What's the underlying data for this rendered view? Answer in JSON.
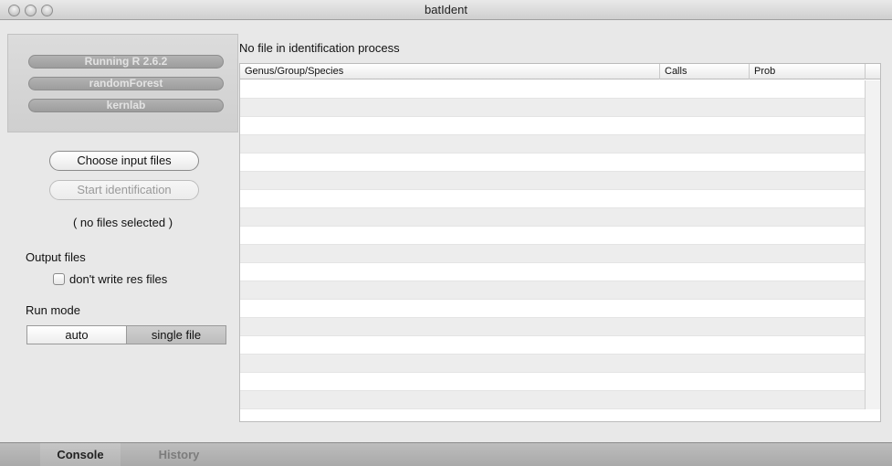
{
  "window": {
    "title": "batIdent"
  },
  "left_panel": {
    "packages": [
      "Running R 2.6.2",
      "randomForest",
      "kernlab"
    ],
    "choose_button": "Choose input files",
    "start_button": "Start identification",
    "selection_status": "( no files selected )",
    "output_label": "Output files",
    "checkbox_label": "don't write res files",
    "run_mode_label": "Run mode",
    "run_mode_options": [
      "auto",
      "single file"
    ],
    "run_mode_selected": "single file"
  },
  "main": {
    "status_heading": "No file in identification process",
    "table": {
      "columns": [
        "Genus/Group/Species",
        "Calls",
        "Prob"
      ],
      "rows": []
    }
  },
  "bottom_tabs": [
    "Console",
    "History"
  ],
  "colors": {
    "window_bg": "#e8e8e8",
    "status_pill": "#a7a7a7",
    "selected_segment": "#c6c6c6"
  }
}
